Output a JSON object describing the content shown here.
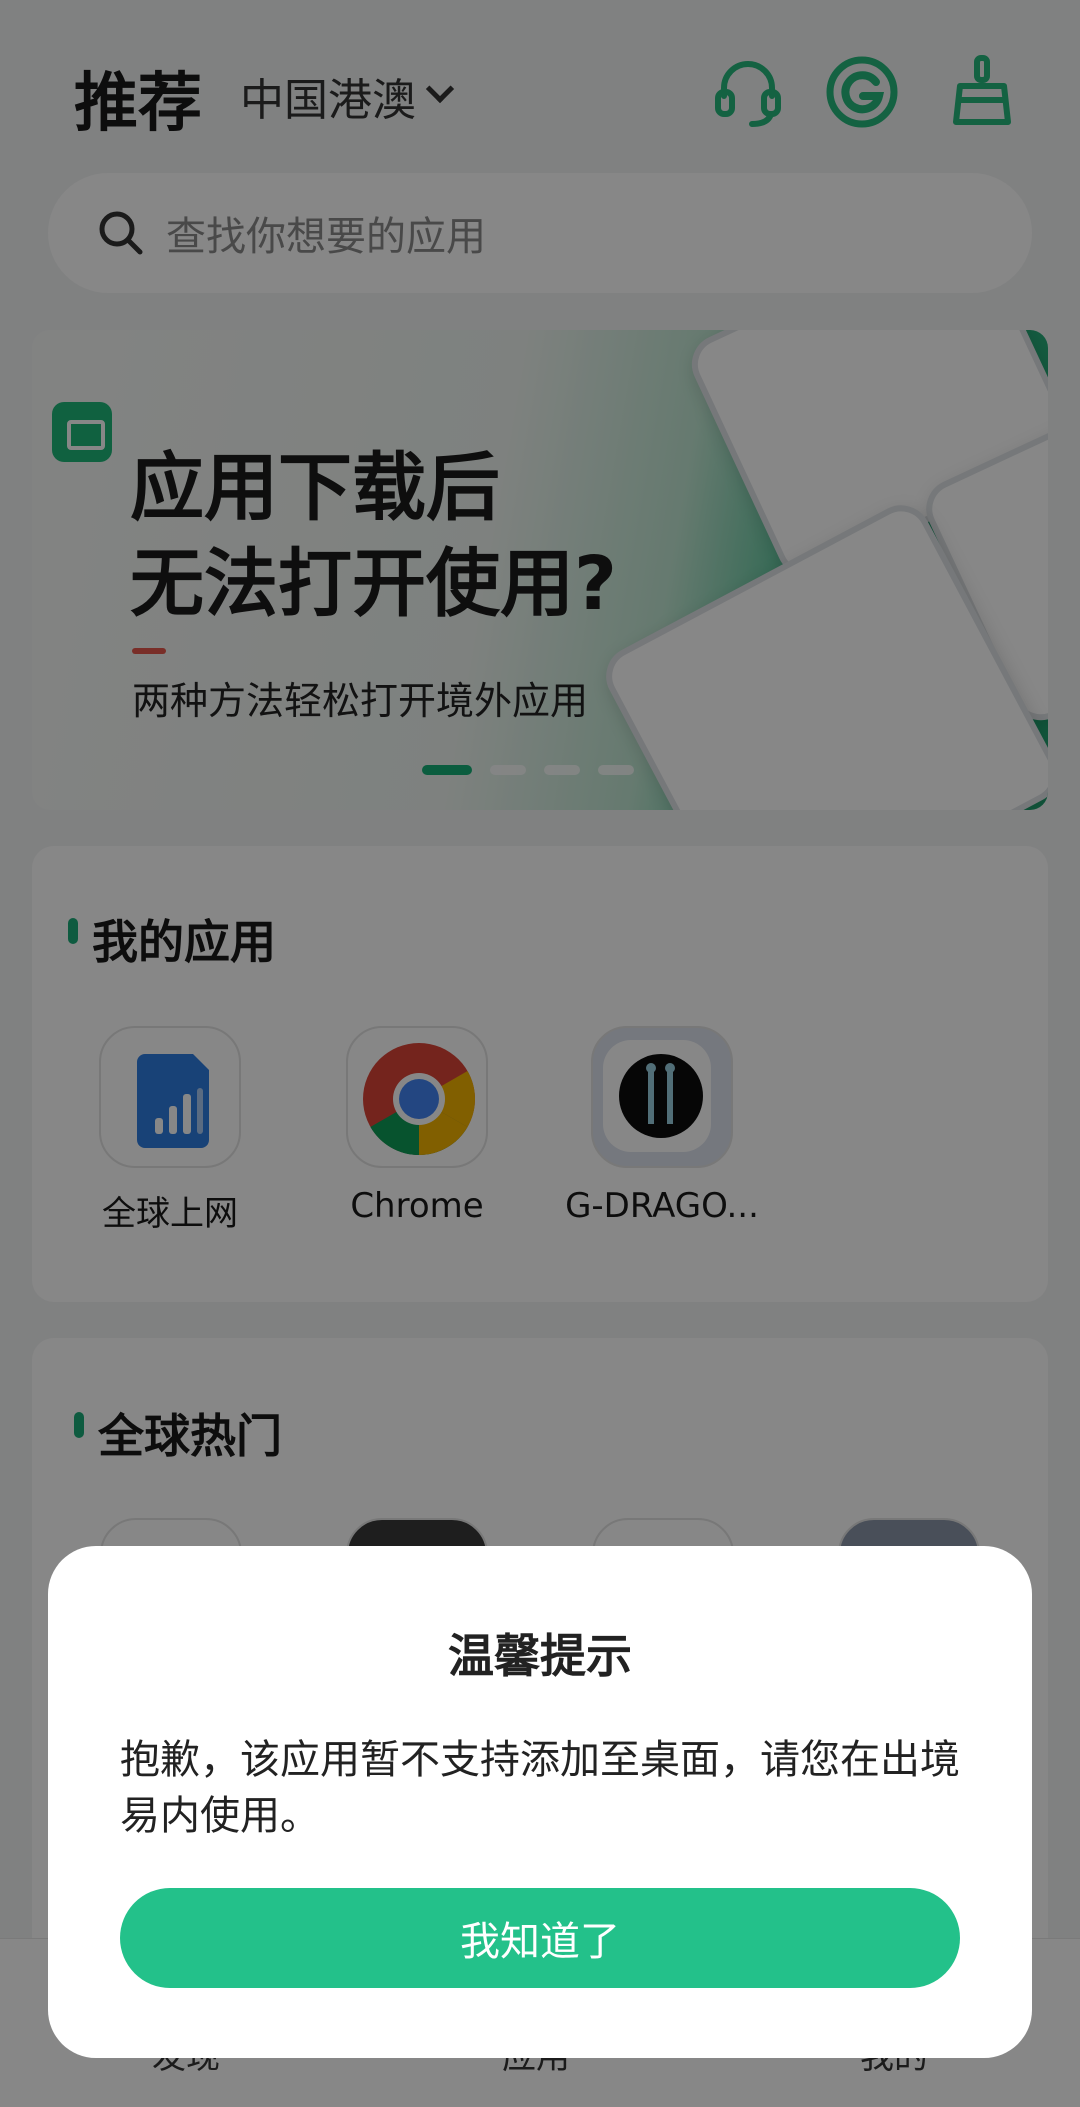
{
  "header": {
    "title": "推荐",
    "region": "中国港澳",
    "icons": [
      "headset-icon",
      "g-logo-icon",
      "broom-icon"
    ]
  },
  "search": {
    "placeholder": "查找你想要的应用"
  },
  "banner": {
    "headline_line1": "应用下载后",
    "headline_line2": "无法打开使用?",
    "subtitle": "两种方法轻松打开境外应用",
    "active_slide": 1,
    "slide_count": 4
  },
  "my_apps": {
    "title": "我的应用",
    "apps": [
      {
        "name": "全球上网",
        "icon": "signal-bars-icon"
      },
      {
        "name": "Chrome",
        "icon": "chrome-icon"
      },
      {
        "name": "G-DRAGO...",
        "icon": "g-dragon-icon"
      }
    ]
  },
  "global_hot": {
    "title": "全球热门"
  },
  "bottom_nav": {
    "items": [
      "发现",
      "应用",
      "我的"
    ]
  },
  "dialog": {
    "title": "温馨提示",
    "message": "抱歉，该应用暂不支持添加至桌面，请您在出境易内使用。",
    "button": "我知道了"
  },
  "colors": {
    "accent": "#23c18a",
    "overlay": "rgba(0,0,0,0.47)"
  }
}
